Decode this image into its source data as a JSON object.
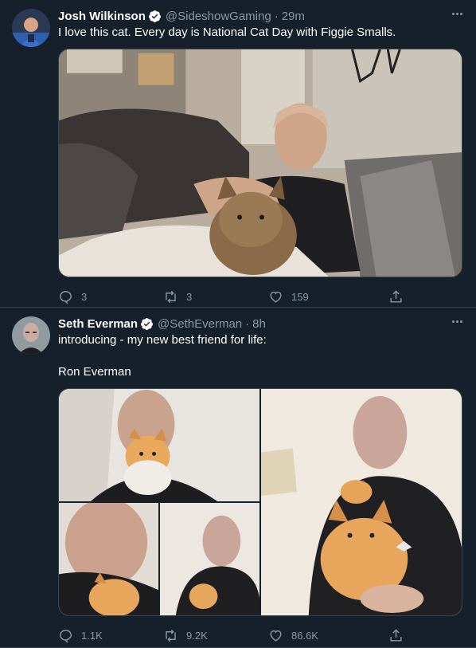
{
  "tweets": [
    {
      "display_name": "Josh Wilkinson",
      "handle": "@SideshowGaming",
      "separator": "·",
      "time": "29m",
      "text": "I love this cat. Every day is National Cat Day with Figgie Smalls.",
      "replies": "3",
      "retweets": "3",
      "likes": "159"
    },
    {
      "display_name": "Seth Everman",
      "handle": "@SethEverman",
      "separator": "·",
      "time": "8h",
      "text_line1": "introducing - my new best friend for life:",
      "text_line2": "Ron Everman",
      "replies": "1.1K",
      "retweets": "9.2K",
      "likes": "86.6K"
    }
  ],
  "icons": {
    "verified": "verified-badge-icon",
    "more": "more-options-icon",
    "reply": "reply-icon",
    "retweet": "retweet-icon",
    "like": "heart-icon",
    "share": "share-icon"
  },
  "colors": {
    "background": "#15202b",
    "border": "#38444d",
    "muted_text": "#8899a6",
    "verified": "#ffffff"
  }
}
